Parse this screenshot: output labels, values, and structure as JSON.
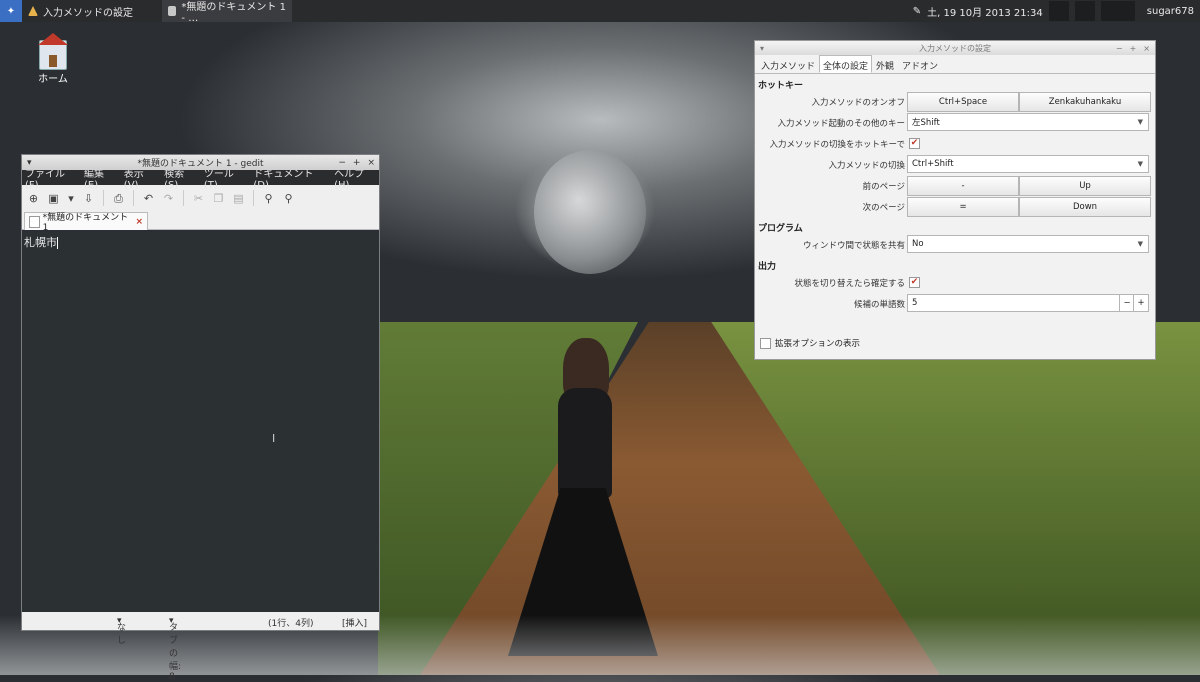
{
  "panel": {
    "task1": "入力メソッドの設定",
    "task2": "*無題のドキュメント 1 - …",
    "ime_status": "あ",
    "clock": "土, 19 10月 2013 21:34",
    "user": "sugar678"
  },
  "desktop": {
    "home_label": "ホーム"
  },
  "gedit": {
    "title": "*無題のドキュメント 1 - gedit",
    "menu": [
      "ファイル(F)",
      "編集(E)",
      "表示(V)",
      "検索(S)",
      "ツール(T)",
      "ドキュメント(D)",
      "ヘルプ(H)"
    ],
    "tab_label": "*無題のドキュメント 1",
    "content": "札幌市",
    "status": {
      "lang": "なし",
      "tab_width": "タブの幅:  8",
      "position": "(1行、4列)",
      "mode": "[挿入]"
    }
  },
  "ime": {
    "title": "入力メソッドの設定",
    "tabs": [
      "入力メソッド",
      "全体の設定",
      "外観",
      "アドオン"
    ],
    "hotkey_section": "ホットキー",
    "onoff_label": "入力メソッドのオンオフ",
    "onoff_key1": "Ctrl+Space",
    "onoff_key2": "Zenkakuhankaku",
    "extra_key_label": "入力メソッド起動のその他のキー",
    "extra_key_value": "左Shift",
    "hotkey_switch_label": "入力メソッドの切換をホットキーで",
    "switch_label": "入力メソッドの切換",
    "switch_value": "Ctrl+Shift",
    "prev_label": "前のページ",
    "prev_key1": "-",
    "prev_key2": "Up",
    "next_label": "次のページ",
    "next_key1": "=",
    "next_key2": "Down",
    "program_section": "プログラム",
    "share_label": "ウィンドウ間で状態を共有",
    "share_value": "No",
    "output_section": "出力",
    "commit_label": "状態を切り替えたら確定する",
    "candidates_label": "候補の単語数",
    "candidates_value": "5",
    "extended_label": "拡張オプションの表示"
  }
}
